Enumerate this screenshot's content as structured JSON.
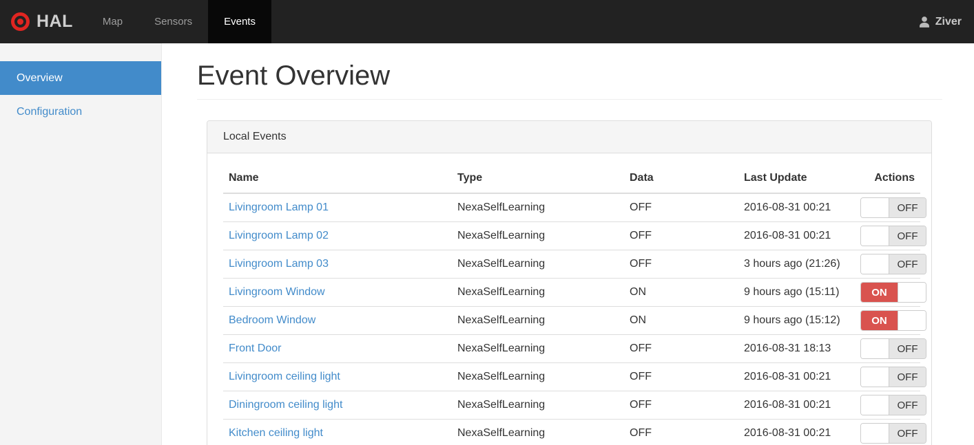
{
  "navbar": {
    "brand": "HAL",
    "logo_icon": "target-icon",
    "items": [
      {
        "label": "Map",
        "active": false
      },
      {
        "label": "Sensors",
        "active": false
      },
      {
        "label": "Events",
        "active": true
      }
    ],
    "user": {
      "icon": "person-icon",
      "name": "Ziver"
    }
  },
  "sidebar": {
    "items": [
      {
        "label": "Overview",
        "active": true
      },
      {
        "label": "Configuration",
        "active": false
      }
    ]
  },
  "main": {
    "title": "Event Overview",
    "panel": {
      "title": "Local Events",
      "table": {
        "columns": [
          "Name",
          "Type",
          "Data",
          "Last Update",
          "Actions"
        ],
        "rows": [
          {
            "name": "Livingroom Lamp 01",
            "type": "NexaSelfLearning",
            "data": "OFF",
            "last_update": "2016-08-31 00:21",
            "toggle": "OFF"
          },
          {
            "name": "Livingroom Lamp 02",
            "type": "NexaSelfLearning",
            "data": "OFF",
            "last_update": "2016-08-31 00:21",
            "toggle": "OFF"
          },
          {
            "name": "Livingroom Lamp 03",
            "type": "NexaSelfLearning",
            "data": "OFF",
            "last_update": "3 hours ago (21:26)",
            "toggle": "OFF"
          },
          {
            "name": "Livingroom Window",
            "type": "NexaSelfLearning",
            "data": "ON",
            "last_update": "9 hours ago (15:11)",
            "toggle": "ON"
          },
          {
            "name": "Bedroom Window",
            "type": "NexaSelfLearning",
            "data": "ON",
            "last_update": "9 hours ago (15:12)",
            "toggle": "ON"
          },
          {
            "name": "Front Door",
            "type": "NexaSelfLearning",
            "data": "OFF",
            "last_update": "2016-08-31 18:13",
            "toggle": "OFF"
          },
          {
            "name": "Livingroom ceiling light",
            "type": "NexaSelfLearning",
            "data": "OFF",
            "last_update": "2016-08-31 00:21",
            "toggle": "OFF"
          },
          {
            "name": "Diningroom ceiling light",
            "type": "NexaSelfLearning",
            "data": "OFF",
            "last_update": "2016-08-31 00:21",
            "toggle": "OFF"
          },
          {
            "name": "Kitchen ceiling light",
            "type": "NexaSelfLearning",
            "data": "OFF",
            "last_update": "2016-08-31 00:21",
            "toggle": "OFF"
          }
        ]
      }
    }
  },
  "colors": {
    "navbar_bg": "#222222",
    "navbar_active_bg": "#080808",
    "brand_red": "#e02521",
    "accent_blue": "#428bca",
    "toggle_on_red": "#d9534f",
    "toggle_off_gray": "#e6e6e6",
    "sidebar_bg": "#f4f4f4",
    "panel_border": "#dddddd"
  }
}
